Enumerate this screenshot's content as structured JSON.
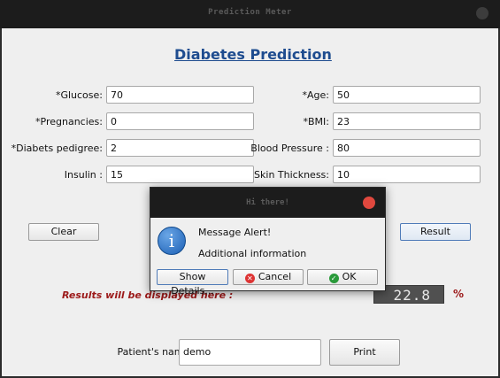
{
  "window": {
    "title": "Prediction Meter"
  },
  "heading": "Diabetes Prediction ",
  "fields": {
    "glucose": {
      "label": "*Glucose:",
      "value": "70"
    },
    "pregnancies": {
      "label": "*Pregnancies:",
      "value": "0"
    },
    "pedigree": {
      "label": "*Diabets pedigree:",
      "value": "2"
    },
    "insulin": {
      "label": "Insulin :",
      "value": "15"
    },
    "age": {
      "label": "*Age:",
      "value": "50"
    },
    "bmi": {
      "label": "*BMI:",
      "value": "23"
    },
    "blood_pressure": {
      "label": "Blood Pressure :",
      "value": "80"
    },
    "skin_thickness": {
      "label": "Skin Thickness:",
      "value": "10"
    }
  },
  "buttons": {
    "clear": "Clear",
    "result": "Result",
    "print": "Print"
  },
  "results": {
    "label": "Results will be displayed here :",
    "value": "22.8",
    "unit": "%"
  },
  "patient": {
    "label": "Patient's name:",
    "value": "demo"
  },
  "dialog": {
    "title": "Hi there!",
    "message": "Message Alert!",
    "info": "Additional information",
    "show_details": "Show Details...",
    "cancel": "Cancel",
    "ok": "OK"
  },
  "colors": {
    "heading": "#1e4c8f",
    "results": "#9c1a1a",
    "close_button": "#e0483e"
  }
}
